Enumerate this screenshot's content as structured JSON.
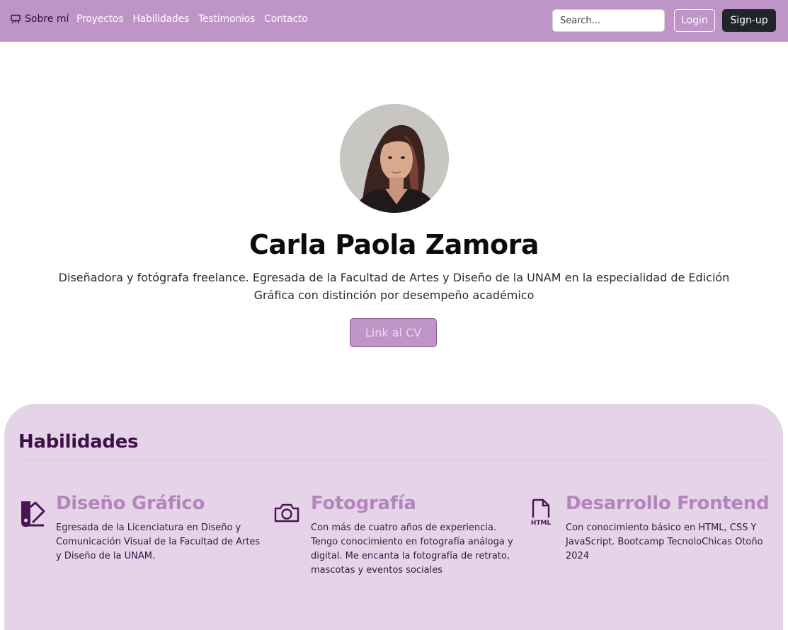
{
  "nav": {
    "brand_label": "Sobre mí",
    "links": [
      "Proyectos",
      "Habilidades",
      "Testimonios",
      "Contacto"
    ],
    "search_placeholder": "Search...",
    "login_label": "Login",
    "signup_label": "Sign-up"
  },
  "hero": {
    "name": "Carla Paola Zamora",
    "bio": "Diseñadora y fotógrafa freelance. Egresada de la Facultad de Artes y Diseño de la UNAM en la especialidad de Edición Gráfica con distinción por desempeño académico",
    "cv_button": "Link al CV"
  },
  "skills": {
    "title": "Habilidades",
    "items": [
      {
        "icon": "palette-swatch-icon",
        "title": "Diseño Gráfico",
        "description": "Egresada de la Licenciatura en Diseño y Comunicación Visual de la Facultad de Artes y Diseño de la UNAM."
      },
      {
        "icon": "camera-icon",
        "title": "Fotografía",
        "description": "Con más de cuatro años de experiencia. Tengo conocimiento en fotografía análoga y digital. Me encanta la fotografía de retrato, mascotas y eventos sociales"
      },
      {
        "icon": "html-file-icon",
        "title": "Desarrollo Frontend",
        "description": "Con conocimiento básico en HTML, CSS Y JavaScript. Bootcamp TecnoloChicas Otoño 2024"
      }
    ]
  },
  "colors": {
    "navbar": "#bf94c6",
    "skills_background": "#e5d4e7",
    "skill_title": "#b386bb",
    "dark_purple": "#3d1147"
  }
}
